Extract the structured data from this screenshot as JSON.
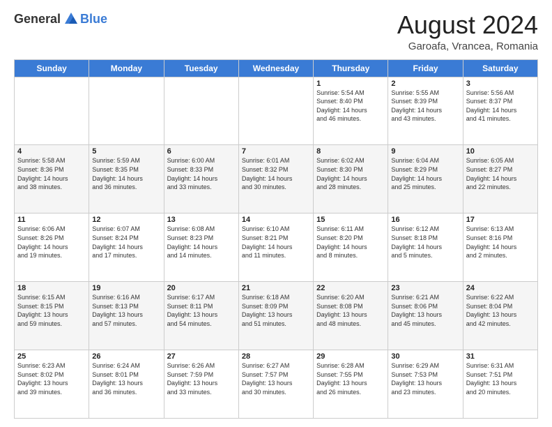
{
  "logo": {
    "general": "General",
    "blue": "Blue"
  },
  "header": {
    "month": "August 2024",
    "location": "Garoafa, Vrancea, Romania"
  },
  "days_of_week": [
    "Sunday",
    "Monday",
    "Tuesday",
    "Wednesday",
    "Thursday",
    "Friday",
    "Saturday"
  ],
  "weeks": [
    [
      {
        "day": "",
        "info": ""
      },
      {
        "day": "",
        "info": ""
      },
      {
        "day": "",
        "info": ""
      },
      {
        "day": "",
        "info": ""
      },
      {
        "day": "1",
        "info": "Sunrise: 5:54 AM\nSunset: 8:40 PM\nDaylight: 14 hours\nand 46 minutes."
      },
      {
        "day": "2",
        "info": "Sunrise: 5:55 AM\nSunset: 8:39 PM\nDaylight: 14 hours\nand 43 minutes."
      },
      {
        "day": "3",
        "info": "Sunrise: 5:56 AM\nSunset: 8:37 PM\nDaylight: 14 hours\nand 41 minutes."
      }
    ],
    [
      {
        "day": "4",
        "info": "Sunrise: 5:58 AM\nSunset: 8:36 PM\nDaylight: 14 hours\nand 38 minutes."
      },
      {
        "day": "5",
        "info": "Sunrise: 5:59 AM\nSunset: 8:35 PM\nDaylight: 14 hours\nand 36 minutes."
      },
      {
        "day": "6",
        "info": "Sunrise: 6:00 AM\nSunset: 8:33 PM\nDaylight: 14 hours\nand 33 minutes."
      },
      {
        "day": "7",
        "info": "Sunrise: 6:01 AM\nSunset: 8:32 PM\nDaylight: 14 hours\nand 30 minutes."
      },
      {
        "day": "8",
        "info": "Sunrise: 6:02 AM\nSunset: 8:30 PM\nDaylight: 14 hours\nand 28 minutes."
      },
      {
        "day": "9",
        "info": "Sunrise: 6:04 AM\nSunset: 8:29 PM\nDaylight: 14 hours\nand 25 minutes."
      },
      {
        "day": "10",
        "info": "Sunrise: 6:05 AM\nSunset: 8:27 PM\nDaylight: 14 hours\nand 22 minutes."
      }
    ],
    [
      {
        "day": "11",
        "info": "Sunrise: 6:06 AM\nSunset: 8:26 PM\nDaylight: 14 hours\nand 19 minutes."
      },
      {
        "day": "12",
        "info": "Sunrise: 6:07 AM\nSunset: 8:24 PM\nDaylight: 14 hours\nand 17 minutes."
      },
      {
        "day": "13",
        "info": "Sunrise: 6:08 AM\nSunset: 8:23 PM\nDaylight: 14 hours\nand 14 minutes."
      },
      {
        "day": "14",
        "info": "Sunrise: 6:10 AM\nSunset: 8:21 PM\nDaylight: 14 hours\nand 11 minutes."
      },
      {
        "day": "15",
        "info": "Sunrise: 6:11 AM\nSunset: 8:20 PM\nDaylight: 14 hours\nand 8 minutes."
      },
      {
        "day": "16",
        "info": "Sunrise: 6:12 AM\nSunset: 8:18 PM\nDaylight: 14 hours\nand 5 minutes."
      },
      {
        "day": "17",
        "info": "Sunrise: 6:13 AM\nSunset: 8:16 PM\nDaylight: 14 hours\nand 2 minutes."
      }
    ],
    [
      {
        "day": "18",
        "info": "Sunrise: 6:15 AM\nSunset: 8:15 PM\nDaylight: 13 hours\nand 59 minutes."
      },
      {
        "day": "19",
        "info": "Sunrise: 6:16 AM\nSunset: 8:13 PM\nDaylight: 13 hours\nand 57 minutes."
      },
      {
        "day": "20",
        "info": "Sunrise: 6:17 AM\nSunset: 8:11 PM\nDaylight: 13 hours\nand 54 minutes."
      },
      {
        "day": "21",
        "info": "Sunrise: 6:18 AM\nSunset: 8:09 PM\nDaylight: 13 hours\nand 51 minutes."
      },
      {
        "day": "22",
        "info": "Sunrise: 6:20 AM\nSunset: 8:08 PM\nDaylight: 13 hours\nand 48 minutes."
      },
      {
        "day": "23",
        "info": "Sunrise: 6:21 AM\nSunset: 8:06 PM\nDaylight: 13 hours\nand 45 minutes."
      },
      {
        "day": "24",
        "info": "Sunrise: 6:22 AM\nSunset: 8:04 PM\nDaylight: 13 hours\nand 42 minutes."
      }
    ],
    [
      {
        "day": "25",
        "info": "Sunrise: 6:23 AM\nSunset: 8:02 PM\nDaylight: 13 hours\nand 39 minutes."
      },
      {
        "day": "26",
        "info": "Sunrise: 6:24 AM\nSunset: 8:01 PM\nDaylight: 13 hours\nand 36 minutes."
      },
      {
        "day": "27",
        "info": "Sunrise: 6:26 AM\nSunset: 7:59 PM\nDaylight: 13 hours\nand 33 minutes."
      },
      {
        "day": "28",
        "info": "Sunrise: 6:27 AM\nSunset: 7:57 PM\nDaylight: 13 hours\nand 30 minutes."
      },
      {
        "day": "29",
        "info": "Sunrise: 6:28 AM\nSunset: 7:55 PM\nDaylight: 13 hours\nand 26 minutes."
      },
      {
        "day": "30",
        "info": "Sunrise: 6:29 AM\nSunset: 7:53 PM\nDaylight: 13 hours\nand 23 minutes."
      },
      {
        "day": "31",
        "info": "Sunrise: 6:31 AM\nSunset: 7:51 PM\nDaylight: 13 hours\nand 20 minutes."
      }
    ]
  ]
}
